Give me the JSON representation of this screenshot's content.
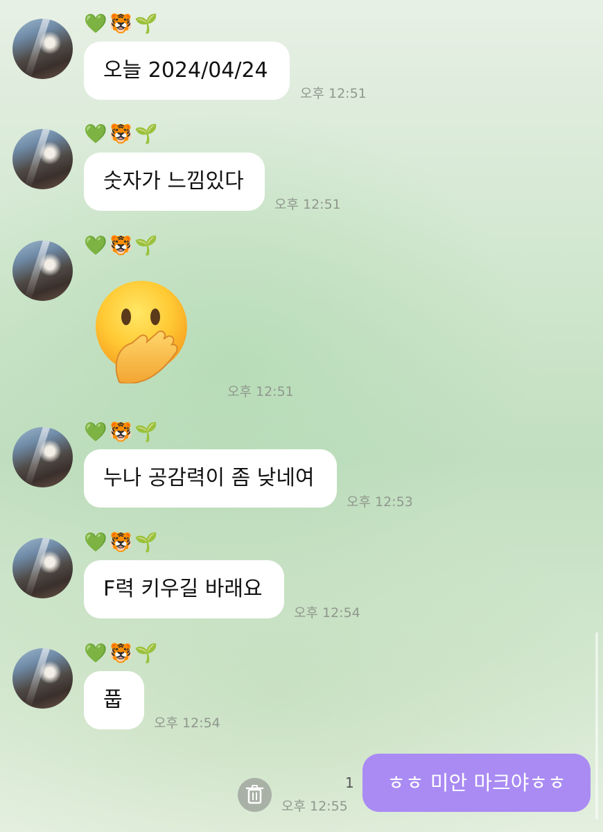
{
  "chat": {
    "sender_tag": "💚🐯🌱",
    "messages": [
      {
        "text": "오늘 2024/04/24",
        "time": "오후 12:51"
      },
      {
        "text": "숫자가 느낌있다",
        "time": "오후 12:51"
      },
      {
        "emoji_name": "face-with-hand-over-mouth",
        "time": "오후 12:51"
      },
      {
        "text": "누나 공감력이 좀 낮네여",
        "time": "오후 12:53"
      },
      {
        "text": "F력 키우길 바래요",
        "time": "오후 12:54"
      },
      {
        "text": "풉",
        "time": "오후 12:54"
      }
    ],
    "sent": {
      "text": "ㅎㅎ 미안 마크야ㅎㅎ",
      "time": "오후 12:55",
      "unread_count": "1"
    }
  },
  "colors": {
    "sent_bubble": "#a98bf3",
    "received_bubble": "#ffffff",
    "background": "#cfe6cd"
  },
  "icons": {
    "delete": "trash-icon"
  }
}
